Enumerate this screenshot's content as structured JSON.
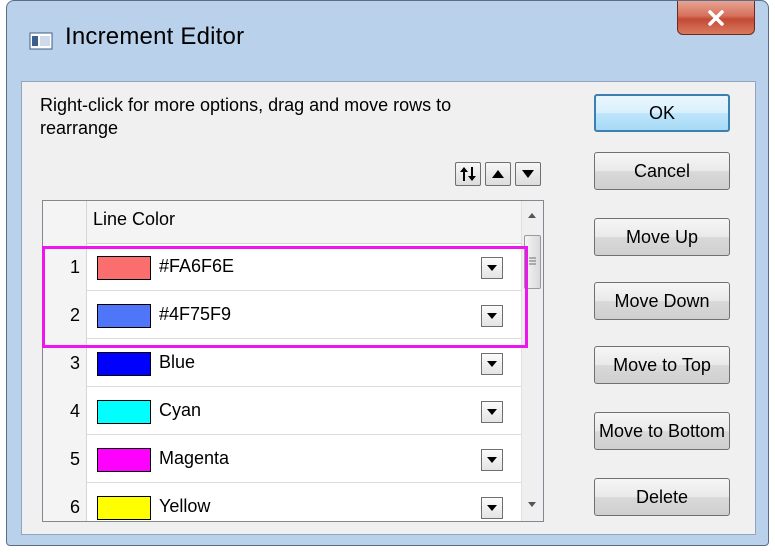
{
  "window": {
    "title": "Increment Editor",
    "close_symbol": "x"
  },
  "instructions": "Right-click for more options, drag and move rows to  rearrange",
  "grid": {
    "column_header": "Line Color",
    "rows": [
      {
        "number": "1",
        "name": "#FA6F6E",
        "color": "#FA6F6E"
      },
      {
        "number": "2",
        "name": "#4F75F9",
        "color": "#4F75F9"
      },
      {
        "number": "3",
        "name": "Blue",
        "color": "#0000FF"
      },
      {
        "number": "4",
        "name": "Cyan",
        "color": "#00FFFF"
      },
      {
        "number": "5",
        "name": "Magenta",
        "color": "#FF00FF"
      },
      {
        "number": "6",
        "name": "Yellow",
        "color": "#FFFF00"
      }
    ]
  },
  "buttons": {
    "ok": "OK",
    "cancel": "Cancel",
    "move_up": "Move Up",
    "move_down": "Move Down",
    "move_to_top": "Move to Top",
    "move_to_bottom": "Move to Bottom",
    "delete": "Delete"
  },
  "icons": {
    "sort_toggle": "sort-updown-icon",
    "row_up": "arrow-up-icon",
    "row_down": "arrow-down-icon",
    "dropdown": "chevron-down-icon"
  },
  "colors": {
    "highlight": "#EE16EE",
    "title_bar": "#B9D1EA",
    "close_button": "#C44A34"
  }
}
